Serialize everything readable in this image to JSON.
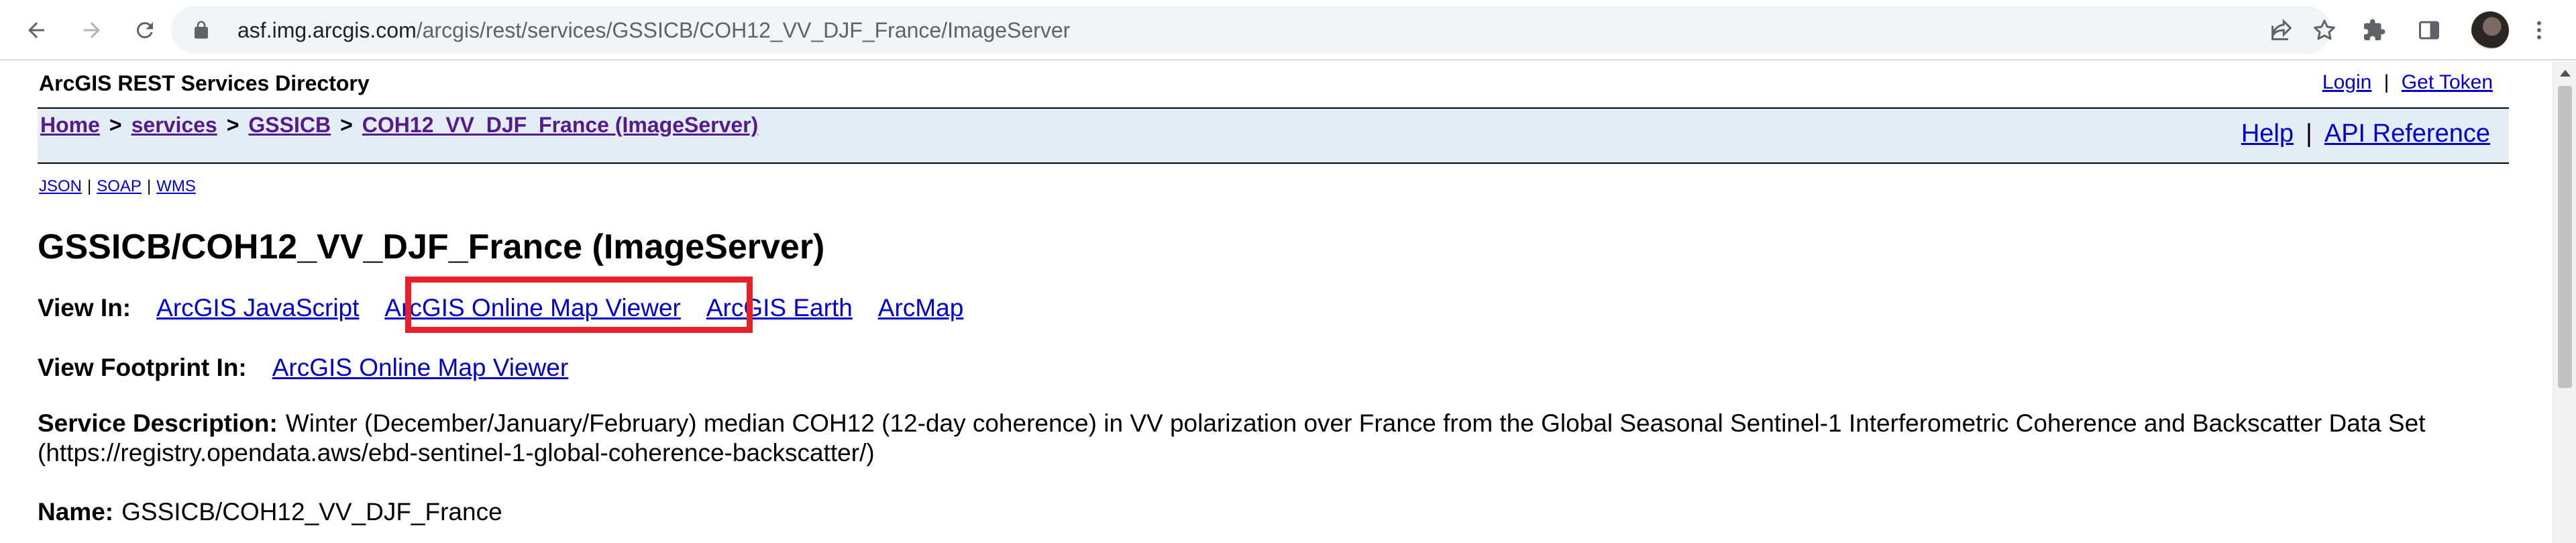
{
  "browser": {
    "url_host": "asf.img.arcgis.com",
    "url_path": "/arcgis/rest/services/GSSICB/COH12_VV_DJF_France/ImageServer",
    "icons": [
      "back-icon",
      "forward-icon",
      "reload-icon",
      "lock-icon",
      "share-icon",
      "bookmark-star-icon",
      "extensions-icon",
      "side-panel-icon",
      "profile-avatar",
      "menu-icon"
    ]
  },
  "header": {
    "site_title": "ArcGIS REST Services Directory",
    "login": "Login",
    "link_separator": "|",
    "get_token": "Get Token"
  },
  "nav": {
    "crumb_sep": ">",
    "breadcrumbs": [
      "Home",
      "services",
      "GSSICB",
      "COH12_VV_DJF_France (ImageServer)"
    ],
    "help": "Help",
    "api_reference": "API Reference"
  },
  "formats": [
    "JSON",
    "SOAP",
    "WMS"
  ],
  "service": {
    "title": "GSSICB/COH12_VV_DJF_France (ImageServer)",
    "view_in_label": "View In:",
    "view_in_links": [
      "ArcGIS JavaScript",
      "ArcGIS Online Map Viewer",
      "ArcGIS Earth",
      "ArcMap"
    ],
    "footprint_label": "View Footprint In:",
    "footprint_link": "ArcGIS Online Map Viewer",
    "description_label": "Service Description:",
    "description": "Winter (December/January/February) median COH12 (12-day coherence) in VV polarization over France from the Global Seasonal Sentinel-1 Interferometric Coherence and Backscatter Data Set (https://registry.opendata.aws/ebd-sentinel-1-global-coherence-backscatter/)",
    "name_label": "Name:",
    "name_value": "GSSICB/COH12_VV_DJF_France"
  },
  "colors": {
    "link": "#0000cc",
    "visited_link": "#551a8b",
    "nav_bg": "#e3edf6",
    "highlight": "#e8202a"
  }
}
